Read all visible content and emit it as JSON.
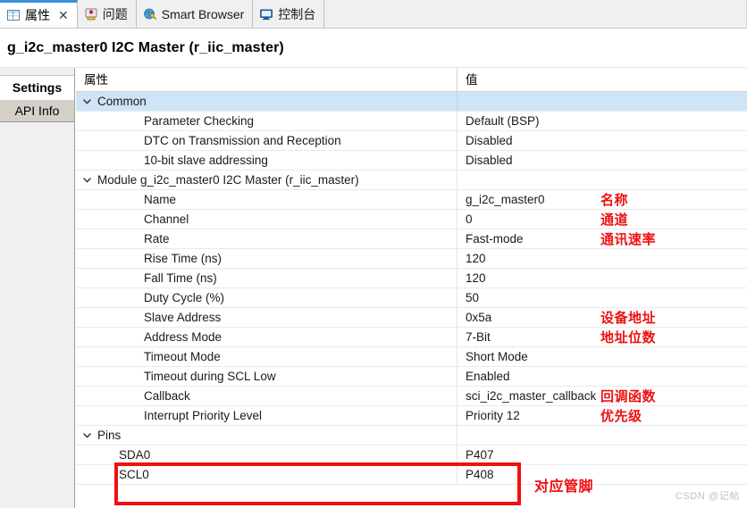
{
  "tabs": [
    {
      "label": "属性",
      "icon": "properties-icon",
      "active": true,
      "closable": true,
      "close_glyph": "✕"
    },
    {
      "label": "问题",
      "icon": "problems-icon",
      "active": false,
      "closable": false,
      "close_glyph": ""
    },
    {
      "label": "Smart Browser",
      "icon": "smart-browser-icon",
      "active": false,
      "closable": false,
      "close_glyph": ""
    },
    {
      "label": "控制台",
      "icon": "console-icon",
      "active": false,
      "closable": false,
      "close_glyph": ""
    }
  ],
  "title": "g_i2c_master0 I2C Master (r_iic_master)",
  "sidebar": {
    "items": [
      {
        "label": "Settings",
        "selected": true
      },
      {
        "label": "API Info",
        "selected": false
      }
    ]
  },
  "table": {
    "headers": {
      "property": "属性",
      "value": "值"
    },
    "rows": [
      {
        "property": "Common",
        "value": "",
        "level": 0,
        "group": true,
        "selected": true,
        "twisty": "chevron-down-icon",
        "annotation": ""
      },
      {
        "property": "Parameter Checking",
        "value": "Default (BSP)",
        "level": 2,
        "group": false,
        "selected": false,
        "twisty": "",
        "annotation": ""
      },
      {
        "property": "DTC on Transmission and Reception",
        "value": "Disabled",
        "level": 2,
        "group": false,
        "selected": false,
        "twisty": "",
        "annotation": ""
      },
      {
        "property": "10-bit slave addressing",
        "value": "Disabled",
        "level": 2,
        "group": false,
        "selected": false,
        "twisty": "",
        "annotation": ""
      },
      {
        "property": "Module g_i2c_master0 I2C Master (r_iic_master)",
        "value": "",
        "level": 0,
        "group": true,
        "selected": false,
        "twisty": "chevron-down-icon",
        "annotation": ""
      },
      {
        "property": "Name",
        "value": "g_i2c_master0",
        "level": 2,
        "group": false,
        "selected": false,
        "twisty": "",
        "annotation": "名称"
      },
      {
        "property": "Channel",
        "value": "0",
        "level": 2,
        "group": false,
        "selected": false,
        "twisty": "",
        "annotation": "通道"
      },
      {
        "property": "Rate",
        "value": "Fast-mode",
        "level": 2,
        "group": false,
        "selected": false,
        "twisty": "",
        "annotation": "通讯速率"
      },
      {
        "property": "Rise Time (ns)",
        "value": "120",
        "level": 2,
        "group": false,
        "selected": false,
        "twisty": "",
        "annotation": ""
      },
      {
        "property": "Fall Time (ns)",
        "value": "120",
        "level": 2,
        "group": false,
        "selected": false,
        "twisty": "",
        "annotation": ""
      },
      {
        "property": "Duty Cycle (%)",
        "value": "50",
        "level": 2,
        "group": false,
        "selected": false,
        "twisty": "",
        "annotation": ""
      },
      {
        "property": "Slave Address",
        "value": "0x5a",
        "level": 2,
        "group": false,
        "selected": false,
        "twisty": "",
        "annotation": "设备地址"
      },
      {
        "property": "Address Mode",
        "value": "7-Bit",
        "level": 2,
        "group": false,
        "selected": false,
        "twisty": "",
        "annotation": "地址位数"
      },
      {
        "property": "Timeout Mode",
        "value": "Short Mode",
        "level": 2,
        "group": false,
        "selected": false,
        "twisty": "",
        "annotation": ""
      },
      {
        "property": "Timeout during SCL Low",
        "value": "Enabled",
        "level": 2,
        "group": false,
        "selected": false,
        "twisty": "",
        "annotation": ""
      },
      {
        "property": "Callback",
        "value": "sci_i2c_master_callback",
        "level": 2,
        "group": false,
        "selected": false,
        "twisty": "",
        "annotation": "回调函数"
      },
      {
        "property": "Interrupt Priority Level",
        "value": "Priority 12",
        "level": 2,
        "group": false,
        "selected": false,
        "twisty": "",
        "annotation": "优先级"
      },
      {
        "property": "Pins",
        "value": "",
        "level": 0,
        "group": true,
        "selected": false,
        "twisty": "chevron-down-icon",
        "annotation": ""
      },
      {
        "property": "SDA0",
        "value": "P407",
        "level": 1,
        "group": false,
        "selected": false,
        "twisty": "",
        "annotation": ""
      },
      {
        "property": "SCL0",
        "value": "P408",
        "level": 1,
        "group": false,
        "selected": false,
        "twisty": "",
        "annotation": ""
      }
    ]
  },
  "annotations": {
    "pins_label": "对应管脚",
    "color": "#f01010"
  },
  "watermark": "CSDN @记帖",
  "colors": {
    "selection": "#cfe4f7",
    "tab_active_accent": "#3a8fd8",
    "annotation_red": "#f01010"
  }
}
